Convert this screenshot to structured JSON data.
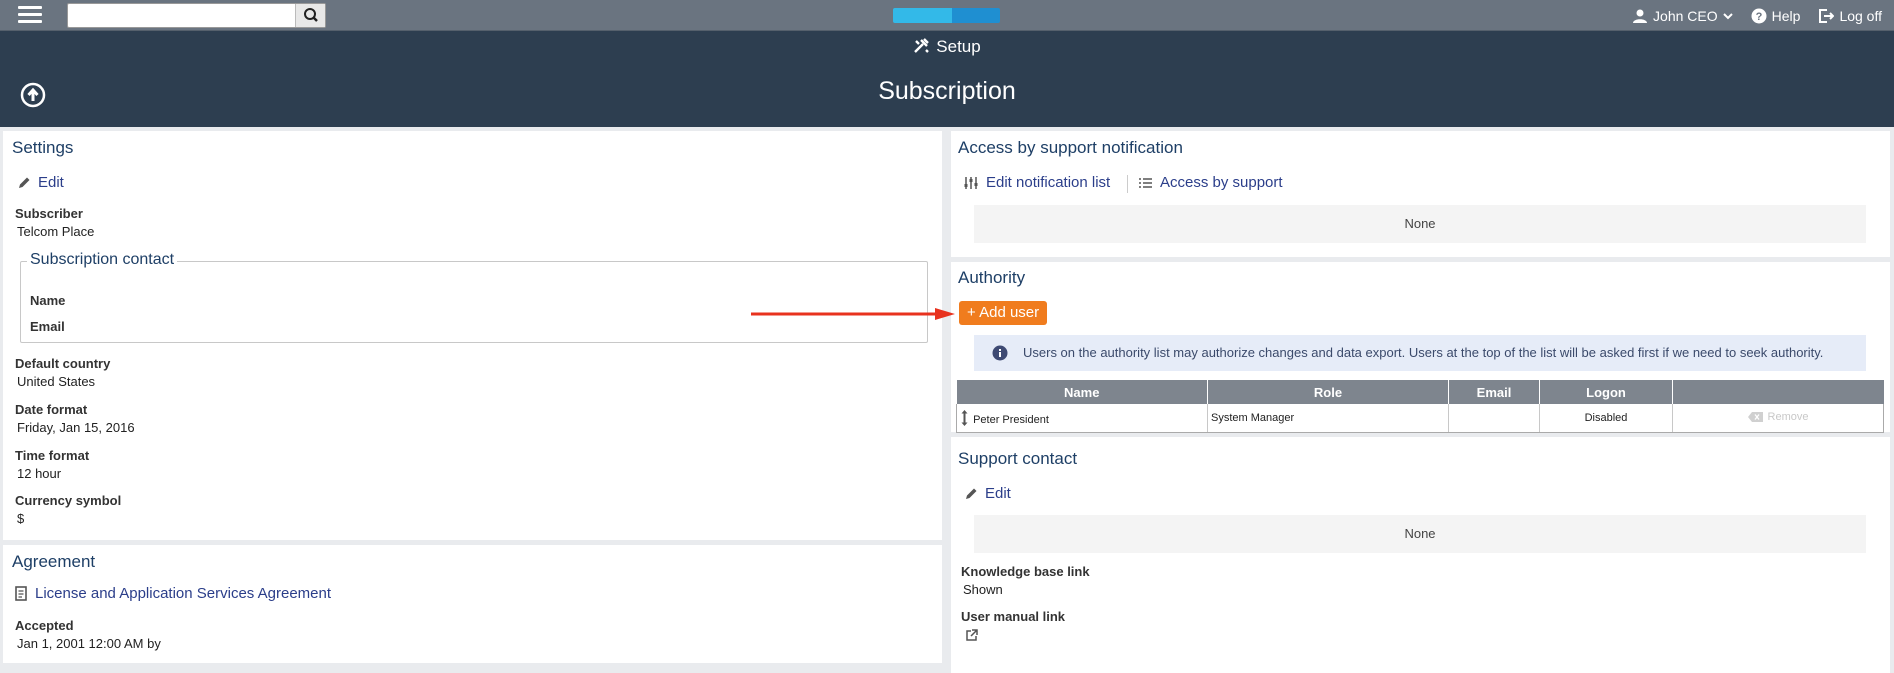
{
  "topbar": {
    "search_placeholder": "",
    "user_label": "John CEO",
    "help_label": "Help",
    "logoff_label": "Log off",
    "logo_color": "#33b9e8"
  },
  "header": {
    "section": "Setup",
    "title": "Subscription",
    "bg_color": "#2d3e50"
  },
  "settings": {
    "title": "Settings",
    "edit_label": "Edit",
    "subscriber_label": "Subscriber",
    "subscriber_value": "Telcom Place",
    "contact_legend": "Subscription contact",
    "contact_name_label": "Name",
    "contact_email_label": "Email",
    "country_label": "Default country",
    "country_value": "United States",
    "date_format_label": "Date format",
    "date_format_value": "Friday, Jan 15, 2016",
    "time_format_label": "Time format",
    "time_format_value": "12 hour",
    "currency_label": "Currency symbol",
    "currency_value": "$"
  },
  "agreement": {
    "title": "Agreement",
    "link_label": "License and Application Services Agreement",
    "accepted_label": "Accepted",
    "accepted_value": "Jan 1, 2001 12:00 AM by"
  },
  "support_notification": {
    "title": "Access by support notification",
    "edit_list_label": "Edit notification list",
    "access_label": "Access by support",
    "none_text": "None"
  },
  "authority": {
    "title": "Authority",
    "add_user_label": "+ Add user",
    "info_text": "Users on the authority list may authorize changes and data export. Users at the top of the list will be asked first if we need to seek authority.",
    "columns": [
      "Name",
      "Role",
      "Email",
      "Logon",
      ""
    ],
    "rows": [
      {
        "name": "Peter President",
        "role": "System Manager",
        "email": "",
        "logon": "Disabled",
        "remove_label": "Remove"
      }
    ],
    "accent_color": "#f07c1e"
  },
  "support_contact": {
    "title": "Support contact",
    "edit_label": "Edit",
    "none_text": "None",
    "kb_label": "Knowledge base link",
    "kb_value": "Shown",
    "manual_label": "User manual link"
  },
  "icons": {
    "menu": "hamburger-icon",
    "search": "search-icon",
    "user": "user-icon",
    "help": "help-icon",
    "logoff": "logoff-icon",
    "setup": "tools-icon",
    "back": "arrow-up-circle-icon",
    "edit": "pencil-icon",
    "sliders": "sliders-icon",
    "list": "list-icon",
    "info": "info-icon",
    "document": "document-icon",
    "external": "external-link-icon",
    "drag": "drag-handle-icon",
    "remove": "backspace-icon"
  },
  "annotation_color": "#e8321e"
}
